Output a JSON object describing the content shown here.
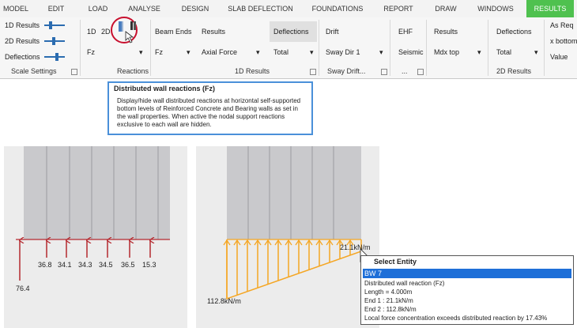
{
  "menu": {
    "tabs": [
      {
        "label": "MODEL"
      },
      {
        "label": "EDIT"
      },
      {
        "label": "LOAD"
      },
      {
        "label": "ANALYSE"
      },
      {
        "label": "DESIGN"
      },
      {
        "label": "SLAB DEFLECTION"
      },
      {
        "label": "FOUNDATIONS"
      },
      {
        "label": "REPORT"
      },
      {
        "label": "DRAW"
      },
      {
        "label": "WINDOWS"
      },
      {
        "label": "RESULTS"
      }
    ],
    "active_color": "#4fc14f"
  },
  "ribbon": {
    "scale": {
      "results_1d": "1D Results",
      "results_2d": "2D Results",
      "deflections": "Deflections",
      "title": "Scale Settings"
    },
    "reactions": {
      "btn_1d": "1D",
      "btn_2d": "2D",
      "component": "Fz",
      "title": "Reactions",
      "wall_icon": "distributed-wall-reaction-icon"
    },
    "results_1d": {
      "beam_ends": "Beam Ends",
      "beam_component": "Fz",
      "results": "Results",
      "axial_force": "Axial Force",
      "title": "1D Results"
    },
    "deflections": {
      "label": "Deflections",
      "total": "Total"
    },
    "sway": {
      "drift": "Drift",
      "sway_dir": "Sway Dir 1",
      "title": "Sway Drift..."
    },
    "ehf": {
      "label": "EHF",
      "seismic": "Seismic",
      "title": "..."
    },
    "results_2d": {
      "results": "Results",
      "mdx_top": "Mdx top",
      "deflections": "Deflections",
      "total": "Total",
      "as_req": "As Req",
      "x_bottom": "x bottom",
      "value": "Value",
      "title": "2D Results"
    }
  },
  "tooltip": {
    "title": "Distributed wall reactions (Fz)",
    "body": "Display/hide wall distributed reactions at horizontal self-supported bottom levels of Reinforced Concrete and Bearing walls as set in the wall properties. When active the nodal support reactions exclusive to each wall are hidden."
  },
  "left_view": {
    "reactions": [
      "76.4",
      "36.8",
      "34.1",
      "34.3",
      "34.5",
      "36.5",
      "15.3"
    ],
    "arrow_color": "#b5292f"
  },
  "right_view": {
    "end1_label": "21.1kN/m",
    "end2_label": "112.8kN/m",
    "arrow_color": "#f5a623"
  },
  "select_entity": {
    "title": "Select Entity",
    "selected": "BW 7",
    "line1": "Distributed wall reaction (Fz)",
    "line2": "Length = 4.000m",
    "line3": "End 1 : 21.1kN/m",
    "line4": "End 2 : 112.8kN/m",
    "line5": "Local force concentration exceeds distributed reaction by 17.43%"
  }
}
